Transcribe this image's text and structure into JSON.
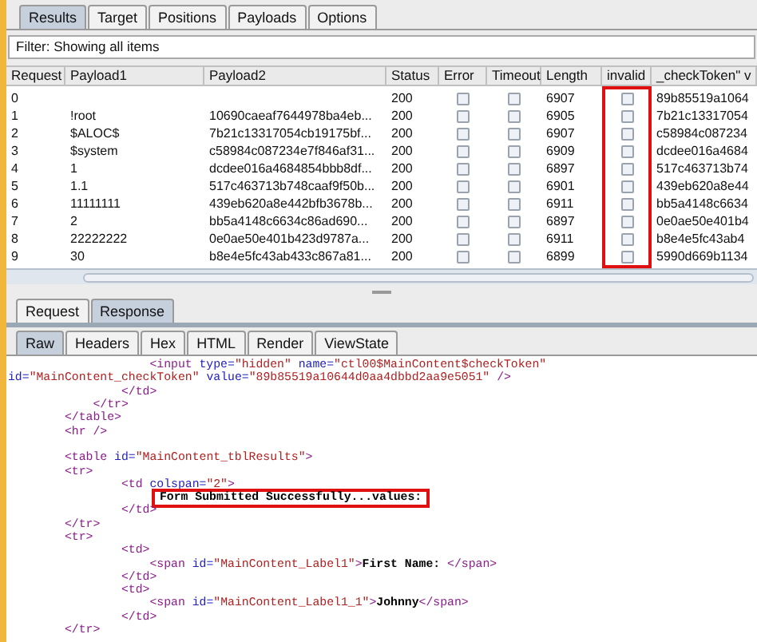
{
  "top_tabs": [
    {
      "label": "Results",
      "selected": true
    },
    {
      "label": "Target",
      "selected": false
    },
    {
      "label": "Positions",
      "selected": false
    },
    {
      "label": "Payloads",
      "selected": false
    },
    {
      "label": "Options",
      "selected": false
    }
  ],
  "filter": {
    "text": "Filter: Showing all items"
  },
  "table": {
    "columns": [
      {
        "label": "Request",
        "kind": "text",
        "highlighted": false
      },
      {
        "label": "Payload1",
        "kind": "text",
        "highlighted": false
      },
      {
        "label": "Payload2",
        "kind": "text",
        "highlighted": false
      },
      {
        "label": "Status",
        "kind": "text",
        "highlighted": false
      },
      {
        "label": "Error",
        "kind": "check",
        "highlighted": false
      },
      {
        "label": "Timeout",
        "kind": "check",
        "highlighted": false
      },
      {
        "label": "Length",
        "kind": "text",
        "highlighted": false
      },
      {
        "label": "invalid",
        "kind": "check",
        "highlighted": true
      },
      {
        "label": "_checkToken\" v",
        "kind": "text",
        "highlighted": false
      }
    ],
    "rows": [
      {
        "cells": [
          "0",
          "",
          "",
          "200",
          false,
          false,
          "6907",
          false,
          "89b85519a1064"
        ]
      },
      {
        "cells": [
          "1",
          "!root",
          "10690caeaf7644978ba4eb...",
          "200",
          false,
          false,
          "6905",
          false,
          "7b21c13317054"
        ]
      },
      {
        "cells": [
          "2",
          "$ALOC$",
          "7b21c13317054cb19175bf...",
          "200",
          false,
          false,
          "6907",
          false,
          "c58984c087234"
        ]
      },
      {
        "cells": [
          "3",
          "$system",
          "c58984c087234e7f846af31...",
          "200",
          false,
          false,
          "6909",
          false,
          "dcdee016a4684"
        ]
      },
      {
        "cells": [
          "4",
          "1",
          "dcdee016a4684854bbb8df...",
          "200",
          false,
          false,
          "6897",
          false,
          "517c463713b74"
        ]
      },
      {
        "cells": [
          "5",
          "1.1",
          "517c463713b748caaf9f50b...",
          "200",
          false,
          false,
          "6901",
          false,
          "439eb620a8e44"
        ]
      },
      {
        "cells": [
          "6",
          "11111111",
          "439eb620a8e442bfb3678b...",
          "200",
          false,
          false,
          "6911",
          false,
          "bb5a4148c6634"
        ]
      },
      {
        "cells": [
          "7",
          "2",
          "bb5a4148c6634c86ad690...",
          "200",
          false,
          false,
          "6897",
          false,
          "0e0ae50e401b4"
        ]
      },
      {
        "cells": [
          "8",
          "22222222",
          "0e0ae50e401b423d9787a...",
          "200",
          false,
          false,
          "6911",
          false,
          "b8e4e5fc43ab4"
        ]
      },
      {
        "cells": [
          "9",
          "30",
          "b8e4e5fc43ab433c867a81...",
          "200",
          false,
          false,
          "6899",
          false,
          "5990d669b1134"
        ]
      }
    ]
  },
  "message_tabs": [
    {
      "label": "Request",
      "selected": false
    },
    {
      "label": "Response",
      "selected": true
    }
  ],
  "view_tabs": [
    {
      "label": "Raw",
      "selected": true
    },
    {
      "label": "Headers",
      "selected": false
    },
    {
      "label": "Hex",
      "selected": false
    },
    {
      "label": "HTML",
      "selected": false
    },
    {
      "label": "Render",
      "selected": false
    },
    {
      "label": "ViewState",
      "selected": false
    }
  ],
  "code": [
    {
      "kind": "code",
      "highlighted": false,
      "tokens": [
        {
          "kind": "tag",
          "text": "                    <input "
        },
        {
          "kind": "attr",
          "text": "type="
        },
        {
          "kind": "value",
          "text": "\"hidden\" "
        },
        {
          "kind": "attr",
          "text": "name="
        },
        {
          "kind": "value",
          "text": "\"ctl00$MainContent$checkToken\""
        }
      ]
    },
    {
      "kind": "code",
      "highlighted": false,
      "tokens": [
        {
          "kind": "attr",
          "text": "id="
        },
        {
          "kind": "value",
          "text": "\"MainContent_checkToken\" "
        },
        {
          "kind": "attr",
          "text": "value="
        },
        {
          "kind": "value",
          "text": "\"89b85519a10644d0aa4dbbd2aa9e5051\" "
        },
        {
          "kind": "tag",
          "text": "/>"
        }
      ]
    },
    {
      "kind": "code",
      "highlighted": false,
      "tokens": [
        {
          "kind": "tag",
          "text": "                </td>"
        }
      ]
    },
    {
      "kind": "code",
      "highlighted": false,
      "tokens": [
        {
          "kind": "tag",
          "text": "            </tr>"
        }
      ]
    },
    {
      "kind": "code",
      "highlighted": false,
      "tokens": [
        {
          "kind": "tag",
          "text": "        </table>"
        }
      ]
    },
    {
      "kind": "code",
      "highlighted": false,
      "tokens": [
        {
          "kind": "tag",
          "text": "        <hr />"
        }
      ]
    },
    {
      "kind": "blank"
    },
    {
      "kind": "code",
      "highlighted": false,
      "tokens": [
        {
          "kind": "tag",
          "text": "        <table "
        },
        {
          "kind": "attr",
          "text": "id="
        },
        {
          "kind": "value",
          "text": "\"MainContent_tblResults\""
        },
        {
          "kind": "tag",
          "text": ">"
        }
      ]
    },
    {
      "kind": "code",
      "highlighted": false,
      "tokens": [
        {
          "kind": "tag",
          "text": "        <tr>"
        }
      ]
    },
    {
      "kind": "code",
      "highlighted": false,
      "tokens": [
        {
          "kind": "tag",
          "text": "                <td "
        },
        {
          "kind": "attr",
          "text": "colspan="
        },
        {
          "kind": "value",
          "text": "\"2\""
        },
        {
          "kind": "tag",
          "text": ">"
        }
      ]
    },
    {
      "kind": "code",
      "highlighted": true,
      "tokens": [
        {
          "kind": "text",
          "text": "Form Submitted Successfully...values:"
        }
      ]
    },
    {
      "kind": "code",
      "highlighted": false,
      "tokens": [
        {
          "kind": "tag",
          "text": "                </td>"
        }
      ]
    },
    {
      "kind": "code",
      "highlighted": false,
      "tokens": [
        {
          "kind": "tag",
          "text": "        </tr>"
        }
      ]
    },
    {
      "kind": "code",
      "highlighted": false,
      "tokens": [
        {
          "kind": "tag",
          "text": "        <tr>"
        }
      ]
    },
    {
      "kind": "code",
      "highlighted": false,
      "tokens": [
        {
          "kind": "tag",
          "text": "                <td>"
        }
      ]
    },
    {
      "kind": "code",
      "highlighted": false,
      "tokens": [
        {
          "kind": "tag",
          "text": "                    <span "
        },
        {
          "kind": "attr",
          "text": "id="
        },
        {
          "kind": "value",
          "text": "\"MainContent_Label1\""
        },
        {
          "kind": "tag",
          "text": ">"
        },
        {
          "kind": "text",
          "text": "First Name: "
        },
        {
          "kind": "tag",
          "text": "</span>"
        }
      ]
    },
    {
      "kind": "code",
      "highlighted": false,
      "tokens": [
        {
          "kind": "tag",
          "text": "                </td>"
        }
      ]
    },
    {
      "kind": "code",
      "highlighted": false,
      "tokens": [
        {
          "kind": "tag",
          "text": "                <td>"
        }
      ]
    },
    {
      "kind": "code",
      "highlighted": false,
      "tokens": [
        {
          "kind": "tag",
          "text": "                    <span "
        },
        {
          "kind": "attr",
          "text": "id="
        },
        {
          "kind": "value",
          "text": "\"MainContent_Label1_1\""
        },
        {
          "kind": "tag",
          "text": ">"
        },
        {
          "kind": "text",
          "text": "Johnny"
        },
        {
          "kind": "tag",
          "text": "</span>"
        }
      ]
    },
    {
      "kind": "code",
      "highlighted": false,
      "tokens": [
        {
          "kind": "tag",
          "text": "                </td>"
        }
      ]
    },
    {
      "kind": "code",
      "highlighted": false,
      "tokens": [
        {
          "kind": "tag",
          "text": "        </tr>"
        }
      ]
    }
  ]
}
